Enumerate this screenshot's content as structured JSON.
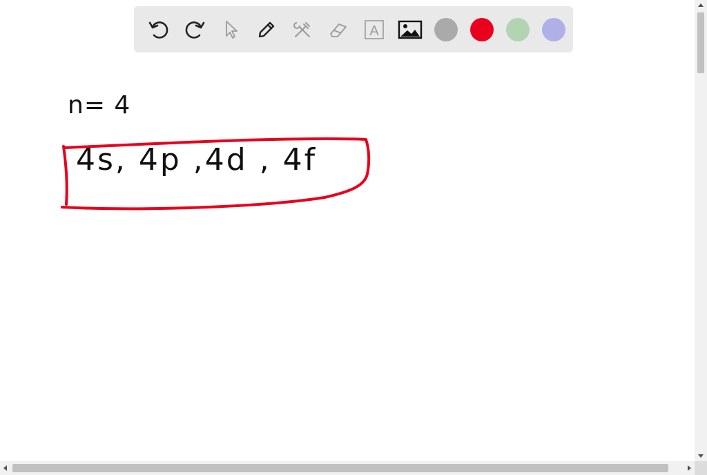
{
  "toolbar": {
    "tools": [
      {
        "icon": "undo-icon"
      },
      {
        "icon": "redo-icon"
      },
      {
        "icon": "pointer-icon"
      },
      {
        "icon": "pen-icon"
      },
      {
        "icon": "tools-icon"
      },
      {
        "icon": "eraser-icon"
      },
      {
        "icon": "text-icon",
        "glyph": "A"
      },
      {
        "icon": "image-icon"
      }
    ],
    "colors": [
      "#aaaaaa",
      "#e8001c",
      "#b3d4b0",
      "#b0b0e8"
    ]
  },
  "canvas": {
    "handwriting": {
      "line1": "n= 4",
      "line2": "4s, 4p ,4d , 4f"
    },
    "highlight_color": "#e8001c"
  }
}
